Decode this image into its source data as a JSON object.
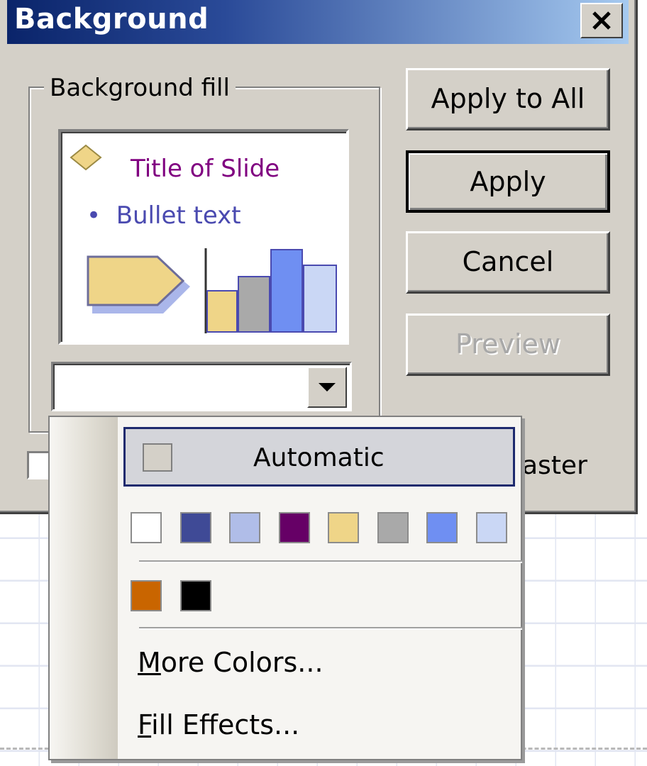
{
  "dialog": {
    "title": "Background",
    "group_label": "Background fill",
    "preview": {
      "slide_title": "Title of Slide",
      "bullet_marker": "•",
      "bullet_text": "Bullet text"
    },
    "checkbox_label_visible": "aster",
    "buttons": {
      "apply_all": "Apply to All",
      "apply": "Apply",
      "cancel": "Cancel",
      "preview": "Preview"
    }
  },
  "menu": {
    "automatic": "Automatic",
    "row1_colors": [
      "#ffffff",
      "#3f4a96",
      "#b0bde8",
      "#660066",
      "#efd588",
      "#a9a9a9",
      "#6f8ff2",
      "#cad7f5"
    ],
    "row2_colors": [
      "#c96500",
      "#000000"
    ],
    "more_colors": {
      "mnemonic": "M",
      "rest": "ore Colors..."
    },
    "fill_effects": {
      "mnemonic": "F",
      "rest": "ill Effects..."
    }
  },
  "preview_colors": {
    "title": "#800080",
    "bullet": "#4a4ab0",
    "shape_fill": "#efd588",
    "shape_shadow": "#aab6ea",
    "bar1": "#efd588",
    "bar2": "#a9a9a9",
    "bar3": "#6f8ff2",
    "bar4": "#cad7f5"
  },
  "icons": {
    "close": "close-icon",
    "dropdown": "chevron-down-icon"
  }
}
